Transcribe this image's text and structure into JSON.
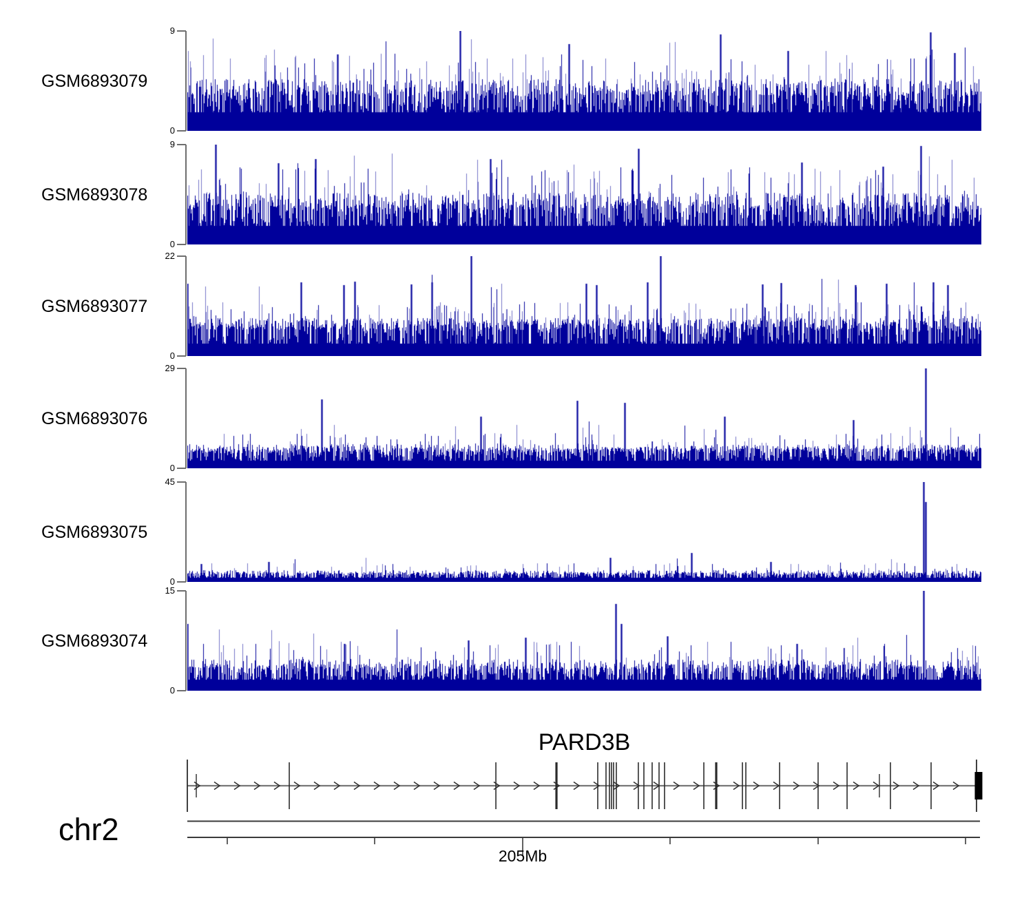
{
  "header": {
    "gene_title": "PARD3B",
    "chromosome_label": "chr2",
    "position_label": "205Mb"
  },
  "colors": {
    "signal": "#00009B",
    "signal_light": "#5C5CC4",
    "axis_gray": "#6e6e6e",
    "gene_line": "#777777",
    "gene_mark": "#2b2b2b",
    "ruler_line": "#3a3a3a"
  },
  "chart_data": {
    "type": "area",
    "title": "PARD3B",
    "xlabel": "chr2 position",
    "x_axis": {
      "labeled_tick": "205Mb",
      "labeled_tick_index": 2,
      "tick_fracs": [
        0.0504,
        0.2363,
        0.4231,
        0.609,
        0.7958,
        0.9818
      ]
    },
    "tracks": [
      {
        "label": "GSM6893079",
        "ymax": 9,
        "ymin": 0,
        "ymax_label": "9",
        "ymin_label": "0",
        "seed": 11,
        "noise": {
          "solid": 1.7,
          "base": 2.4,
          "mid": 3.9,
          "p_mid": 0.45,
          "hi": 5.8,
          "p_hi": 0.09,
          "xhi": 7.3,
          "p_xhi": 0.012,
          "p_dip": 0.03
        },
        "peaks": [
          {
            "f": 0.189,
            "v": 6.9
          },
          {
            "f": 0.3435,
            "v": 9.0
          },
          {
            "f": 0.481,
            "v": 7.8
          },
          {
            "f": 0.672,
            "v": 8.7
          },
          {
            "f": 0.757,
            "v": 7.2
          },
          {
            "f": 0.9367,
            "v": 8.9
          },
          {
            "f": 0.967,
            "v": 7.0
          }
        ]
      },
      {
        "label": "GSM6893078",
        "ymax": 9,
        "ymin": 0,
        "ymax_label": "9",
        "ymin_label": "0",
        "seed": 22,
        "noise": {
          "solid": 1.7,
          "base": 2.4,
          "mid": 3.9,
          "p_mid": 0.43,
          "hi": 5.8,
          "p_hi": 0.09,
          "xhi": 7.3,
          "p_xhi": 0.012,
          "p_dip": 0.035
        },
        "peaks": [
          {
            "f": 0.0356,
            "v": 9.0
          },
          {
            "f": 0.1145,
            "v": 7.3
          },
          {
            "f": 0.1613,
            "v": 7.7
          },
          {
            "f": 0.3816,
            "v": 7.7
          },
          {
            "f": 0.569,
            "v": 8.6
          },
          {
            "f": 0.7745,
            "v": 7.4
          },
          {
            "f": 0.8768,
            "v": 7.0
          },
          {
            "f": 0.9245,
            "v": 8.9
          }
        ]
      },
      {
        "label": "GSM6893077",
        "ymax": 22,
        "ymin": 0,
        "ymax_label": "22",
        "ymin_label": "0",
        "seed": 33,
        "noise": {
          "solid": 2.8,
          "base": 5.2,
          "mid": 7.0,
          "p_mid": 0.45,
          "hi": 10.0,
          "p_hi": 0.12,
          "xhi": 15.8,
          "p_xhi": 0.013,
          "p_dip": 0.05
        },
        "peaks": [
          {
            "f": 0.0,
            "v": 16.0
          },
          {
            "f": 0.1431,
            "v": 16.2
          },
          {
            "f": 0.1969,
            "v": 15.6
          },
          {
            "f": 0.2107,
            "v": 16.4
          },
          {
            "f": 0.2819,
            "v": 15.8
          },
          {
            "f": 0.3079,
            "v": 16.2
          },
          {
            "f": 0.3573,
            "v": 22.0
          },
          {
            "f": 0.5022,
            "v": 16.0
          },
          {
            "f": 0.5152,
            "v": 15.7
          },
          {
            "f": 0.5802,
            "v": 16.3
          },
          {
            "f": 0.5967,
            "v": 22.0
          },
          {
            "f": 0.725,
            "v": 15.8
          },
          {
            "f": 0.7485,
            "v": 16.1
          },
          {
            "f": 0.8422,
            "v": 15.6
          },
          {
            "f": 0.8812,
            "v": 16.0
          },
          {
            "f": 0.9402,
            "v": 16.3
          },
          {
            "f": 0.9584,
            "v": 15.7
          }
        ]
      },
      {
        "label": "GSM6893076",
        "ymax": 29,
        "ymin": 0,
        "ymax_label": "29",
        "ymin_label": "0",
        "seed": 44,
        "noise": {
          "solid": 2.2,
          "base": 4.0,
          "mid": 5.8,
          "p_mid": 0.4,
          "hi": 8.5,
          "p_hi": 0.09,
          "xhi": 12.5,
          "p_xhi": 0.01,
          "p_dip": 0.04
        },
        "peaks": [
          {
            "f": 0.1691,
            "v": 20.0
          },
          {
            "f": 0.3695,
            "v": 15.0
          },
          {
            "f": 0.4909,
            "v": 19.5
          },
          {
            "f": 0.5516,
            "v": 19.0
          },
          {
            "f": 0.6774,
            "v": 15.0
          },
          {
            "f": 0.8396,
            "v": 14.0
          },
          {
            "f": 0.9306,
            "v": 29.0
          }
        ]
      },
      {
        "label": "GSM6893075",
        "ymax": 45,
        "ymin": 0,
        "ymax_label": "45",
        "ymin_label": "0",
        "seed": 55,
        "noise": {
          "solid": 1.9,
          "base": 2.8,
          "mid": 4.4,
          "p_mid": 0.3,
          "hi": 7.2,
          "p_hi": 0.06,
          "xhi": 9.5,
          "p_xhi": 0.008,
          "p_dip": 0.03
        },
        "peaks": [
          {
            "f": 0.0173,
            "v": 8.0
          },
          {
            "f": 0.1023,
            "v": 9.0
          },
          {
            "f": 0.5333,
            "v": 11.0
          },
          {
            "f": 0.6357,
            "v": 13.0
          },
          {
            "f": 0.7355,
            "v": 9.0
          },
          {
            "f": 0.928,
            "v": 45.0
          },
          {
            "f": 0.9308,
            "v": 36.0
          }
        ]
      },
      {
        "label": "GSM6893074",
        "ymax": 15,
        "ymin": 0,
        "ymax_label": "15",
        "ymin_label": "0",
        "seed": 66,
        "noise": {
          "solid": 1.7,
          "base": 2.6,
          "mid": 4.0,
          "p_mid": 0.32,
          "hi": 6.2,
          "p_hi": 0.07,
          "xhi": 8.3,
          "p_xhi": 0.01,
          "p_dip": 0.03
        },
        "peaks": [
          {
            "f": 0.0,
            "v": 10.0
          },
          {
            "f": 0.1977,
            "v": 7.0
          },
          {
            "f": 0.3539,
            "v": 7.5
          },
          {
            "f": 0.4258,
            "v": 8.0
          },
          {
            "f": 0.5403,
            "v": 13.0
          },
          {
            "f": 0.5472,
            "v": 10.0
          },
          {
            "f": 0.6054,
            "v": 8.2
          },
          {
            "f": 0.7684,
            "v": 7.0
          },
          {
            "f": 0.928,
            "v": 15.0
          }
        ]
      }
    ],
    "gene_model": {
      "name": "PARD3B",
      "chromosome": "chr2",
      "strand_direction": "right",
      "exon_fracs": [
        {
          "f": 0.0,
          "t": "tall"
        },
        {
          "f": 0.0113,
          "t": "small"
        },
        {
          "f": 0.1284,
          "t": "n"
        },
        {
          "f": 0.3886,
          "t": "n"
        },
        {
          "f": 0.4649,
          "t": "bold"
        },
        {
          "f": 0.5169,
          "t": "n"
        },
        {
          "f": 0.5273,
          "t": "n"
        },
        {
          "f": 0.5316,
          "t": "n"
        },
        {
          "f": 0.5342,
          "t": "n"
        },
        {
          "f": 0.5368,
          "t": "n"
        },
        {
          "f": 0.5403,
          "t": "n"
        },
        {
          "f": 0.568,
          "t": "n"
        },
        {
          "f": 0.575,
          "t": "n"
        },
        {
          "f": 0.5854,
          "t": "n"
        },
        {
          "f": 0.5941,
          "t": "n"
        },
        {
          "f": 0.601,
          "t": "n"
        },
        {
          "f": 0.6505,
          "t": "n"
        },
        {
          "f": 0.6661,
          "t": "bold"
        },
        {
          "f": 0.6991,
          "t": "n"
        },
        {
          "f": 0.7034,
          "t": "n"
        },
        {
          "f": 0.7459,
          "t": "n"
        },
        {
          "f": 0.7944,
          "t": "n"
        },
        {
          "f": 0.8309,
          "t": "n"
        },
        {
          "f": 0.8716,
          "t": "small"
        },
        {
          "f": 0.8855,
          "t": "n"
        },
        {
          "f": 0.9367,
          "t": "n"
        },
        {
          "f": 0.9939,
          "t": "tall"
        }
      ],
      "end_block_frac": 0.9965
    }
  }
}
